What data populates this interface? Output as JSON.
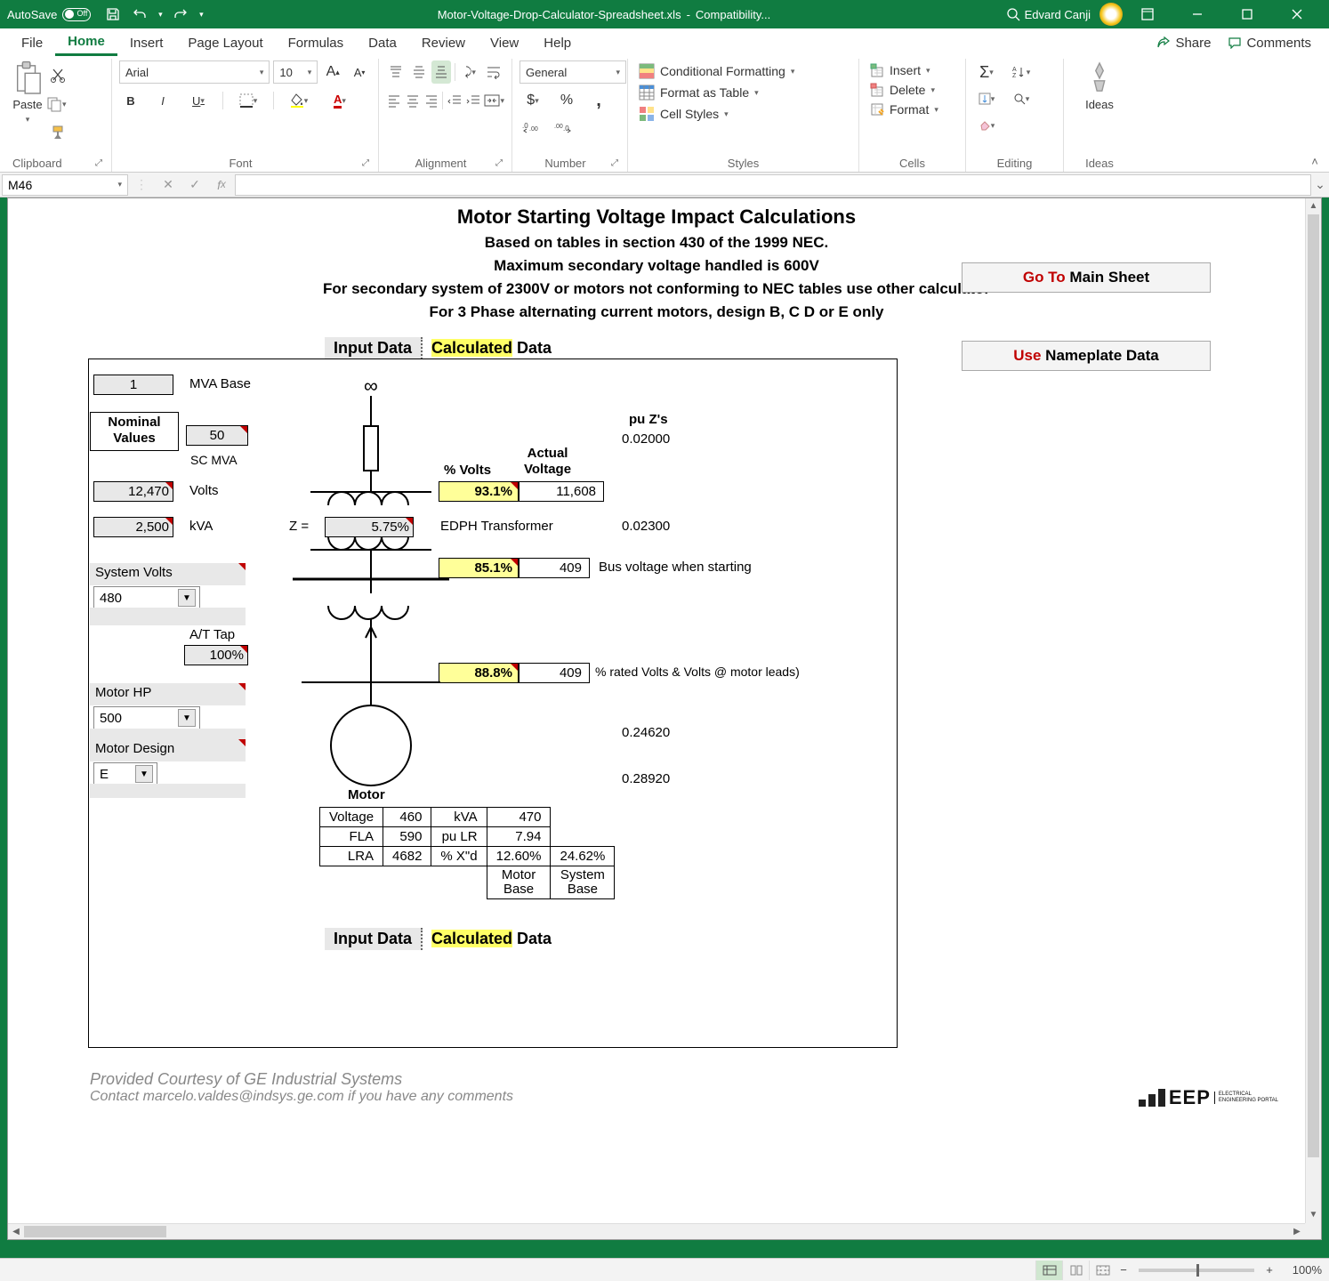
{
  "titlebar": {
    "autosave_label": "AutoSave",
    "autosave_state": "Off",
    "filename": "Motor-Voltage-Drop-Calculator-Spreadsheet.xls",
    "mode": "Compatibility...",
    "user": "Edvard Canji"
  },
  "tabs": {
    "file": "File",
    "home": "Home",
    "insert": "Insert",
    "page_layout": "Page Layout",
    "formulas": "Formulas",
    "data": "Data",
    "review": "Review",
    "view": "View",
    "help": "Help",
    "share": "Share",
    "comments": "Comments"
  },
  "ribbon": {
    "clipboard": {
      "paste": "Paste",
      "label": "Clipboard"
    },
    "font": {
      "name": "Arial",
      "size": "10",
      "label": "Font"
    },
    "alignment": {
      "label": "Alignment"
    },
    "number": {
      "format": "General",
      "label": "Number"
    },
    "styles": {
      "cond": "Conditional Formatting",
      "table": "Format as Table",
      "cell": "Cell Styles",
      "label": "Styles"
    },
    "cells": {
      "insert": "Insert",
      "delete": "Delete",
      "format": "Format",
      "label": "Cells"
    },
    "editing": {
      "label": "Editing"
    },
    "ideas": {
      "btn": "Ideas",
      "label": "Ideas"
    }
  },
  "formula_bar": {
    "name_box": "M46",
    "formula": ""
  },
  "sheet": {
    "title": "Motor Starting Voltage Impact Calculations",
    "sub1": "Based on tables in section 430 of the 1999 NEC.",
    "sub2": "Maximum secondary voltage handled is 600V",
    "sub3": "For secondary system of 2300V or motors not conforming to NEC tables use other calculator",
    "sub4": "For 3 Phase alternating current motors, design B, C D or E only",
    "hdr_input": "Input Data",
    "hdr_calc_hl": "Calculated",
    "hdr_calc_rest": " Data",
    "goto_red": "Go To ",
    "goto_rest": "Main Sheet",
    "use_red": "Use ",
    "use_rest": "Nameplate Data",
    "mva_base": "1",
    "mva_base_lbl": "MVA Base",
    "nominal_hdr": "Nominal\nValues",
    "scmva": "50",
    "scmva_lbl": "SC MVA",
    "volts": "12,470",
    "volts_lbl": "Volts",
    "kva": "2,500",
    "kva_lbl": "kVA",
    "z_lbl": "Z  =",
    "z_val": "5.75%",
    "transformer_lbl": "EDPH Transformer",
    "sys_volts_lbl": "System Volts",
    "sys_volts": "480",
    "at_tap_lbl": "A/T Tap",
    "at_tap": "100%",
    "motor_hp_lbl": "Motor HP",
    "motor_hp": "500",
    "motor_design_lbl": "Motor  Design",
    "motor_design": "E",
    "pct_volts_hdr": "% Volts",
    "actual_v_hdr": "Actual\nVoltage",
    "pu_z_hdr": "pu Z's",
    "pu_z1": "0.02000",
    "pu_z2": "0.02300",
    "pu_z3": "0.24620",
    "pu_z4": "0.28920",
    "r1_pct": "93.1%",
    "r1_v": "11,608",
    "r2_pct": "85.1%",
    "r2_v": "409",
    "r2_note": "Bus voltage when starting",
    "r3_pct": "88.8%",
    "r3_v": "409",
    "r3_note": "% rated Volts & Volts @ motor leads)",
    "motor_lbl": "Motor",
    "mt": {
      "voltage": "Voltage",
      "voltage_v": "460",
      "kva": "kVA",
      "kva_v": "470",
      "fla": "FLA",
      "fla_v": "590",
      "pulr": "pu LR",
      "pulr_v": "7.94",
      "lra": "LRA",
      "lra_v": "4682",
      "pxd": "% X\"d",
      "pxd_v1": "12.60%",
      "pxd_v2": "24.62%",
      "mbase": "Motor\nBase",
      "sbase": "System\nBase"
    },
    "footer1": "Provided Courtesy of GE Industrial Systems",
    "footer2": "Contact marcelo.valdes@indsys.ge.com if you have any comments",
    "eep": "EEP",
    "eep_sub": "ELECTRICAL\nENGINEERING PORTAL"
  },
  "statusbar": {
    "zoom": "100%"
  }
}
